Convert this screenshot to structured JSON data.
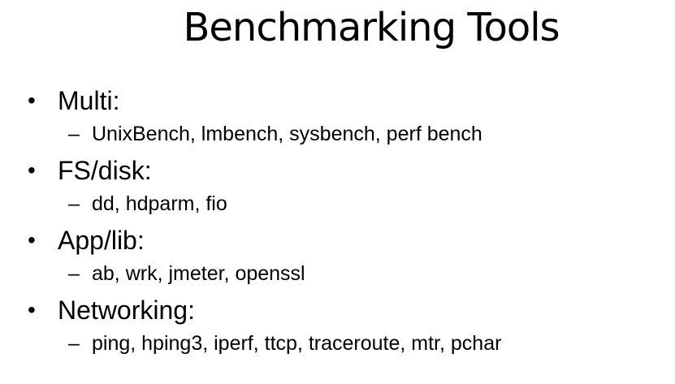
{
  "slide": {
    "title": "Benchmarking Tools",
    "bullet_marker": "•",
    "sub_marker": "–",
    "items": [
      {
        "label": "Multi:",
        "sub": "UnixBench, lmbench, sysbench, perf bench"
      },
      {
        "label": "FS/disk:",
        "sub": "dd, hdparm, fio"
      },
      {
        "label": "App/lib:",
        "sub": "ab, wrk, jmeter, openssl"
      },
      {
        "label": "Networking:",
        "sub": "ping, hping3, iperf, ttcp, traceroute, mtr, pchar"
      }
    ]
  }
}
